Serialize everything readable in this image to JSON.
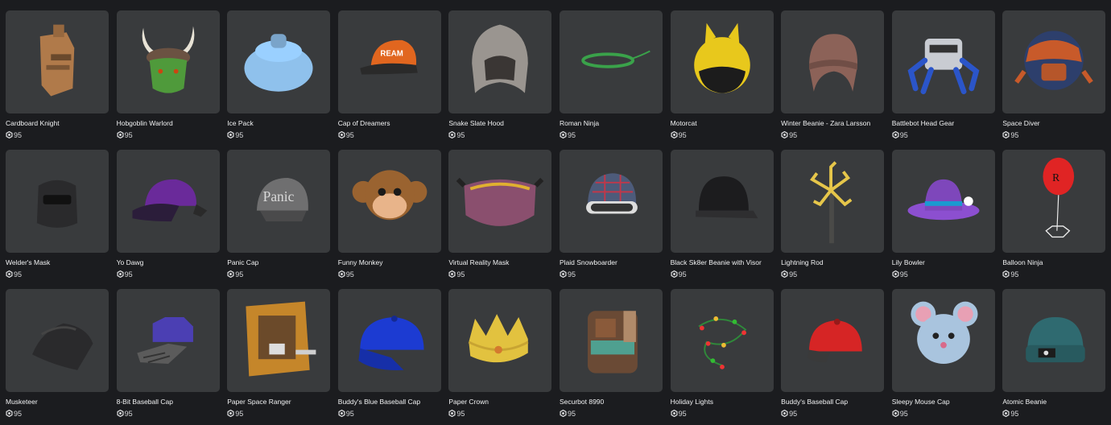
{
  "currency_icon": "robux-icon",
  "items": [
    {
      "name": "Cardboard Knight",
      "price": "95",
      "icon": "cardboard-knight-helmet-icon",
      "color": "#b07a4a"
    },
    {
      "name": "Hobgoblin Warlord",
      "price": "95",
      "icon": "horned-goblin-helmet-icon",
      "color": "#4f9a3b"
    },
    {
      "name": "Ice Pack",
      "price": "95",
      "icon": "ice-pack-icon",
      "color": "#8fc1ec"
    },
    {
      "name": "Cap of Dreamers",
      "price": "95",
      "icon": "baseball-cap-icon",
      "color": "#e1661f"
    },
    {
      "name": "Snake Slate Hood",
      "price": "95",
      "icon": "stone-hood-icon",
      "color": "#9a9590"
    },
    {
      "name": "Roman Ninja",
      "price": "95",
      "icon": "laurel-headband-icon",
      "color": "#3aa24a"
    },
    {
      "name": "Motorcat",
      "price": "95",
      "icon": "cat-ear-helmet-icon",
      "color": "#e8c81c"
    },
    {
      "name": "Winter Beanie - Zara Larsson",
      "price": "95",
      "icon": "winter-beanie-icon",
      "color": "#8c6258"
    },
    {
      "name": "Battlebot Head Gear",
      "price": "95",
      "icon": "robot-head-gear-icon",
      "color": "#2b55c9"
    },
    {
      "name": "Space Diver",
      "price": "95",
      "icon": "space-helmet-icon",
      "color": "#2d3f6c"
    },
    {
      "name": "Welder's Mask",
      "price": "95",
      "icon": "welder-mask-icon",
      "color": "#2a2a2c"
    },
    {
      "name": "Yo Dawg",
      "price": "95",
      "icon": "sideways-cap-icon",
      "color": "#6a2a9a"
    },
    {
      "name": "Panic Cap",
      "price": "95",
      "icon": "text-cap-icon",
      "color": "#6f6f70"
    },
    {
      "name": "Funny Monkey",
      "price": "95",
      "icon": "monkey-face-icon",
      "color": "#9a6330"
    },
    {
      "name": "Virtual Reality Mask",
      "price": "95",
      "icon": "vr-goggles-icon",
      "color": "#8a4f6e"
    },
    {
      "name": "Plaid Snowboarder",
      "price": "95",
      "icon": "snowboard-helmet-icon",
      "color": "#4d5b7a"
    },
    {
      "name": "Black Sk8er Beanie with Visor",
      "price": "95",
      "icon": "skater-helmet-icon",
      "color": "#1c1c1e"
    },
    {
      "name": "Lightning Rod",
      "price": "95",
      "icon": "lightning-rod-icon",
      "color": "#e6c64a"
    },
    {
      "name": "Lily Bowler",
      "price": "95",
      "icon": "bowler-hat-icon",
      "color": "#8c4fd0"
    },
    {
      "name": "Balloon Ninja",
      "price": "95",
      "icon": "balloon-icon",
      "color": "#e02424"
    },
    {
      "name": "Musketeer",
      "price": "95",
      "icon": "musketeer-hat-icon",
      "color": "#2a2a2c"
    },
    {
      "name": "8-Bit Baseball Cap",
      "price": "95",
      "icon": "pixel-cap-icon",
      "color": "#4b3fb3"
    },
    {
      "name": "Paper Space Ranger",
      "price": "95",
      "icon": "cardboard-box-helmet-icon",
      "color": "#c5862a"
    },
    {
      "name": "Buddy's Blue Baseball Cap",
      "price": "95",
      "icon": "blue-baseball-cap-icon",
      "color": "#1c3bd2"
    },
    {
      "name": "Paper Crown",
      "price": "95",
      "icon": "paper-crown-icon",
      "color": "#e2c23f"
    },
    {
      "name": "Securbot 8990",
      "price": "95",
      "icon": "security-robot-head-icon",
      "color": "#6a4a35"
    },
    {
      "name": "Holiday Lights",
      "price": "95",
      "icon": "holiday-lights-icon",
      "color": "#2f8a3a"
    },
    {
      "name": "Buddy's Baseball Cap",
      "price": "95",
      "icon": "red-baseball-cap-icon",
      "color": "#d62525"
    },
    {
      "name": "Sleepy Mouse Cap",
      "price": "95",
      "icon": "mouse-hat-icon",
      "color": "#a9c4de"
    },
    {
      "name": "Atomic Beanie",
      "price": "95",
      "icon": "knit-beanie-icon",
      "color": "#2f6a70"
    }
  ]
}
